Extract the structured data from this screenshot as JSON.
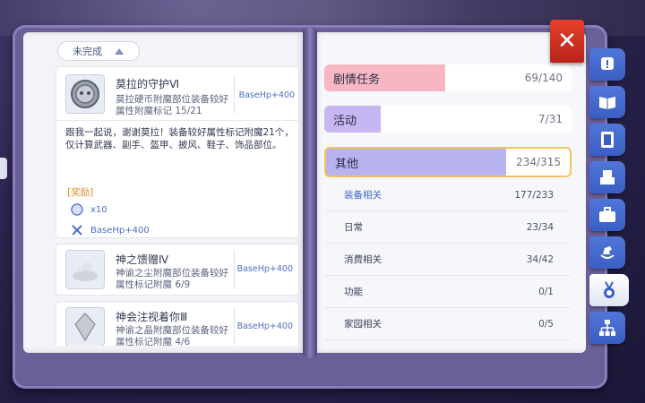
{
  "filter": {
    "label": "未完成"
  },
  "quests": [
    {
      "title": "莫拉的守护Ⅵ",
      "desc": "莫拉硬币附魔部位装备较好属性附魔标记",
      "progress": "15/21",
      "bonus": "BaseHp+400",
      "story": "跟我一起说，谢谢莫拉！装备较好属性标记附魔21个，仅计算武器、副手、盔甲、披风、鞋子、饰品部位。",
      "reward_label": "[奖励]",
      "rewards": [
        {
          "icon": "token-icon",
          "text": "x10"
        },
        {
          "icon": "crossed-swords-icon",
          "text": "BaseHp+400"
        }
      ]
    },
    {
      "title": "神之馈赠Ⅳ",
      "desc": "神谕之尘附魔部位装备较好属性标记附魔",
      "progress": "6/9",
      "bonus": "BaseHp+400"
    },
    {
      "title": "神会注视着你Ⅲ",
      "desc": "神谕之晶附魔部位装备较好属性标记附魔",
      "progress": "4/6",
      "bonus": "BaseHp+400"
    }
  ],
  "categories": [
    {
      "name": "剧情任务",
      "count": "69/140",
      "fraction": 0.49,
      "color": "#f6b7c3"
    },
    {
      "name": "活动",
      "count": "7/31",
      "fraction": 0.23,
      "color": "#c7b6ef"
    },
    {
      "name": "其他",
      "count": "234/315",
      "fraction": 0.74,
      "color": "#b7b3ee"
    }
  ],
  "subcategories": [
    {
      "name": "装备相关",
      "count": "177/233"
    },
    {
      "name": "日常",
      "count": "23/34"
    },
    {
      "name": "消费相关",
      "count": "34/42"
    },
    {
      "name": "功能",
      "count": "0/1"
    },
    {
      "name": "家园相关",
      "count": "0/5"
    }
  ],
  "tabs": [
    "exclaim-icon",
    "book-icon",
    "card-icon",
    "throne-icon",
    "toolbox-icon",
    "rocking-horse-icon",
    "medal-icon",
    "hierarchy-icon"
  ],
  "close_symbol": "✕"
}
